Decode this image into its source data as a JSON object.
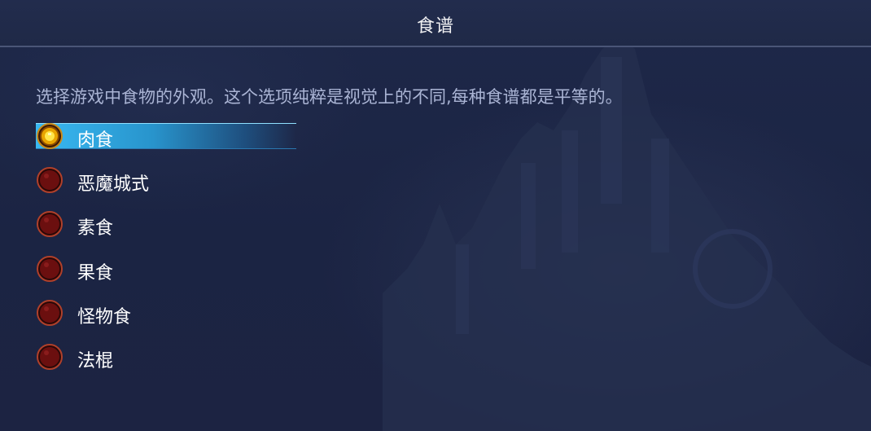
{
  "header": {
    "title": "食谱"
  },
  "description": "选择游戏中食物的外观。这个选项纯粹是视觉上的不同,每种食谱都是平等的。",
  "options": [
    {
      "label": "肉食",
      "selected": true
    },
    {
      "label": "恶魔城式",
      "selected": false
    },
    {
      "label": "素食",
      "selected": false
    },
    {
      "label": "果食",
      "selected": false
    },
    {
      "label": "怪物食",
      "selected": false
    },
    {
      "label": "法棍",
      "selected": false
    }
  ],
  "colors": {
    "background": "#1c2544",
    "highlight": "#39b9f2",
    "radio_off": "#6b0f0f",
    "radio_on": "#ffcc00",
    "description_text": "#aab4d4"
  }
}
